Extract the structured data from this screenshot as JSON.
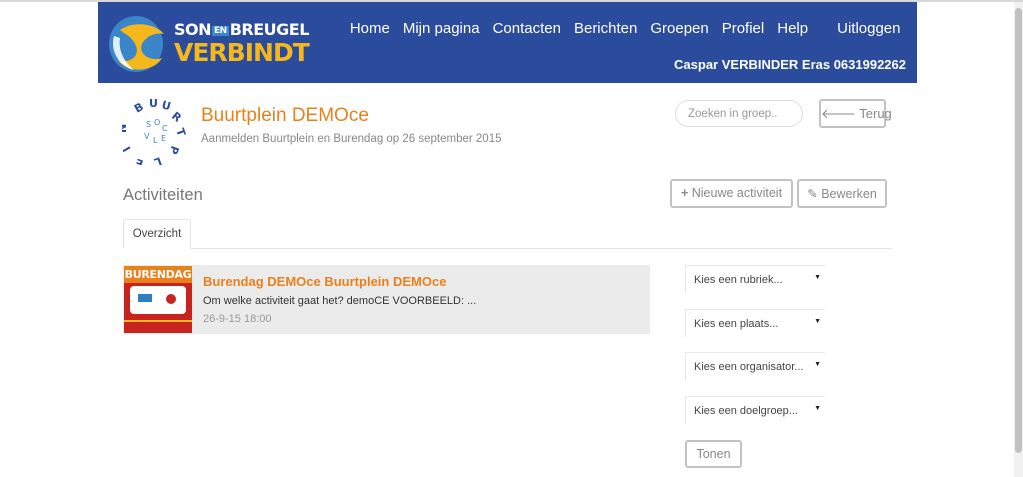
{
  "brand": {
    "line1_a": "SON",
    "line1_en": "EN",
    "line1_b": "BREUGEL",
    "line2": "VERBINDT",
    "accent_color": "#2b4b9c",
    "logo_yellow": "#f5b81c"
  },
  "nav": {
    "links": [
      "Home",
      "Mijn pagina",
      "Contacten",
      "Berichten",
      "Groepen",
      "Profiel",
      "Help"
    ],
    "logout": "Uitloggen",
    "user": "Caspar VERBINDER Eras 0631992262"
  },
  "group": {
    "logo_letters": "BUURTPLEIN",
    "title": "Buurtplein DEMOce",
    "subtitle": "Aanmelden Buurtplein en Burendag op 26 september 2015",
    "title_color": "#e8811b"
  },
  "search": {
    "placeholder": "Zoeken in groep.."
  },
  "buttons": {
    "back": "Terug",
    "new_activity": "Nieuwe activiteit",
    "edit": "Bewerken",
    "show": "Tonen"
  },
  "section": {
    "title": "Activiteiten"
  },
  "tabs": [
    {
      "label": "Overzicht"
    }
  ],
  "activities": [
    {
      "image_banner": "BURENDAG",
      "title": "Burendag DEMOce Buurtplein DEMOce",
      "description": "Om welke activiteit gaat het? demoCE VOORBEELD: ...",
      "date": "26-9-15 18:00"
    }
  ],
  "filters": [
    {
      "label": "Kies een rubriek..."
    },
    {
      "label": "Kies een plaats..."
    },
    {
      "label": "Kies een organisator..."
    },
    {
      "label": "Kies een doelgroep..."
    }
  ]
}
